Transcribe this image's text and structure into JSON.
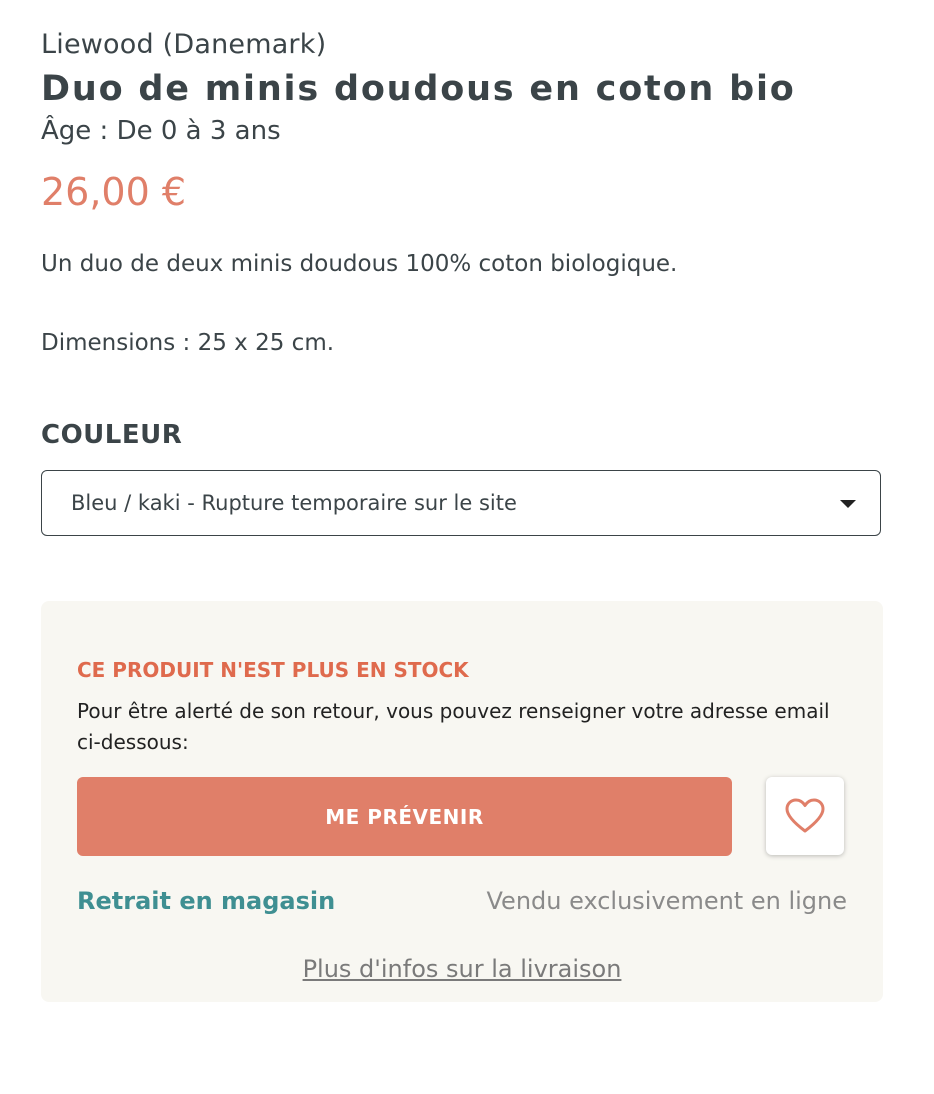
{
  "product": {
    "brand": "Liewood (Danemark)",
    "title": "Duo de minis doudous en coton bio",
    "age": "Âge : De 0 à 3 ans",
    "price": "26,00 €",
    "description": "Un duo de deux minis doudous 100% coton biologique.",
    "dimensions": "Dimensions : 25 x 25 cm."
  },
  "variant": {
    "label": "COULEUR",
    "selected": "Bleu / kaki - Rupture temporaire sur le site",
    "arrow_icon": "caret-down-icon"
  },
  "stock_panel": {
    "title": "CE PRODUIT N'EST PLUS EN STOCK",
    "text": "Pour être alerté de son retour, vous pouvez renseigner votre adresse email ci-dessous:",
    "notify_button": "ME PRÉVENIR",
    "favorite_icon": "heart-icon",
    "pickup_label": "Retrait en magasin",
    "online_label": "Vendu exclusivement en ligne",
    "delivery_link": "Plus d'infos sur la livraison"
  },
  "colors": {
    "text": "#3b4448",
    "accent": "#e07f69",
    "alert": "#df6a4d",
    "teal": "#3f8f92",
    "panel_bg": "#f8f7f2"
  }
}
